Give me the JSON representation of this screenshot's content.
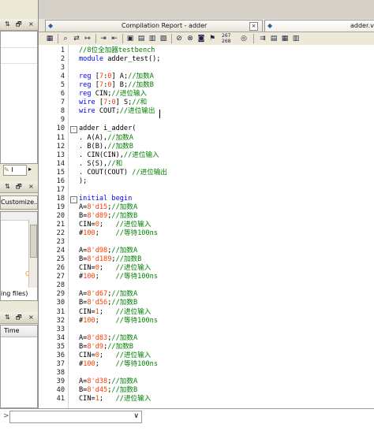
{
  "left_panel": {
    "panel1_buttons": [
      "⇅",
      "🗗",
      "×"
    ],
    "tab_label": "I",
    "panel2_buttons": [
      "⇅",
      "🗗",
      "×"
    ],
    "customize_label": "Customize...",
    "orange_char": "C",
    "files_text": "ing files)",
    "panel3_buttons": [
      "⇅",
      "🗗",
      "×"
    ],
    "time_header": "Time"
  },
  "tabs": {
    "tab1": "Compilation Report - adder",
    "tab2": "adder.v"
  },
  "toolbar": {
    "counter_top": "267",
    "counter_bottom": "268"
  },
  "editor": {
    "lines": [
      {
        "n": "1",
        "t": [
          [
            "c",
            "//8位全加器testbench"
          ]
        ]
      },
      {
        "n": "2",
        "t": [
          [
            "k",
            "module "
          ],
          [
            "p",
            "adder_test();"
          ]
        ]
      },
      {
        "n": "3",
        "t": []
      },
      {
        "n": "4",
        "t": [
          [
            "k",
            "reg "
          ],
          [
            "p",
            "["
          ],
          [
            "n",
            "7"
          ],
          [
            "p",
            ":"
          ],
          [
            "n",
            "0"
          ],
          [
            "p",
            "] A;"
          ],
          [
            "c",
            "//加数A"
          ]
        ]
      },
      {
        "n": "5",
        "t": [
          [
            "k",
            "reg "
          ],
          [
            "p",
            "["
          ],
          [
            "n",
            "7"
          ],
          [
            "p",
            ":"
          ],
          [
            "n",
            "0"
          ],
          [
            "p",
            "] B;"
          ],
          [
            "c",
            "//加数B"
          ]
        ]
      },
      {
        "n": "6",
        "t": [
          [
            "k",
            "reg "
          ],
          [
            "p",
            "CIN;"
          ],
          [
            "c",
            "//进位输入"
          ]
        ]
      },
      {
        "n": "7",
        "t": [
          [
            "k",
            "wire "
          ],
          [
            "p",
            "["
          ],
          [
            "n",
            "7"
          ],
          [
            "p",
            ":"
          ],
          [
            "n",
            "0"
          ],
          [
            "p",
            "] S;"
          ],
          [
            "c",
            "//和"
          ]
        ]
      },
      {
        "n": "8",
        "t": [
          [
            "k",
            "wire "
          ],
          [
            "p",
            "COUT;"
          ],
          [
            "c",
            "//进位输出"
          ]
        ]
      },
      {
        "n": "9",
        "t": []
      },
      {
        "n": "10",
        "fold": "-",
        "t": [
          [
            "p",
            "adder i_adder("
          ]
        ]
      },
      {
        "n": "11",
        "t": [
          [
            "p",
            ". A(A),"
          ],
          [
            "c",
            "//加数A"
          ]
        ]
      },
      {
        "n": "12",
        "t": [
          [
            "p",
            ". B(B),"
          ],
          [
            "c",
            "//加数B"
          ]
        ]
      },
      {
        "n": "13",
        "t": [
          [
            "p",
            ". CIN(CIN),"
          ],
          [
            "c",
            "//进位输入"
          ]
        ]
      },
      {
        "n": "14",
        "t": [
          [
            "p",
            ". S(S),"
          ],
          [
            "c",
            "//和"
          ]
        ]
      },
      {
        "n": "15",
        "t": [
          [
            "p",
            ". COUT(COUT) "
          ],
          [
            "c",
            "//进位输出"
          ]
        ]
      },
      {
        "n": "16",
        "t": [
          [
            "p",
            ");"
          ]
        ]
      },
      {
        "n": "17",
        "t": []
      },
      {
        "n": "18",
        "fold": "-",
        "t": [
          [
            "k",
            "initial begin"
          ]
        ]
      },
      {
        "n": "19",
        "t": [
          [
            "p",
            "A="
          ],
          [
            "n",
            "8'd15"
          ],
          [
            "p",
            ";"
          ],
          [
            "c",
            "//加数A"
          ]
        ]
      },
      {
        "n": "20",
        "t": [
          [
            "p",
            "B="
          ],
          [
            "n",
            "8'd89"
          ],
          [
            "p",
            ";"
          ],
          [
            "c",
            "//加数B"
          ]
        ]
      },
      {
        "n": "21",
        "t": [
          [
            "p",
            "CIN="
          ],
          [
            "n",
            "0"
          ],
          [
            "p",
            ";   "
          ],
          [
            "c",
            "//进位输入"
          ]
        ]
      },
      {
        "n": "22",
        "t": [
          [
            "p",
            "#"
          ],
          [
            "n",
            "100"
          ],
          [
            "p",
            ";    "
          ],
          [
            "c",
            "//等待100ns"
          ]
        ]
      },
      {
        "n": "23",
        "t": []
      },
      {
        "n": "24",
        "t": [
          [
            "p",
            "A="
          ],
          [
            "n",
            "8'd98"
          ],
          [
            "p",
            ";"
          ],
          [
            "c",
            "//加数A"
          ]
        ]
      },
      {
        "n": "25",
        "t": [
          [
            "p",
            "B="
          ],
          [
            "n",
            "8'd189"
          ],
          [
            "p",
            ";"
          ],
          [
            "c",
            "//加数B"
          ]
        ]
      },
      {
        "n": "26",
        "t": [
          [
            "p",
            "CIN="
          ],
          [
            "n",
            "0"
          ],
          [
            "p",
            ";   "
          ],
          [
            "c",
            "//进位输入"
          ]
        ]
      },
      {
        "n": "27",
        "t": [
          [
            "p",
            "#"
          ],
          [
            "n",
            "100"
          ],
          [
            "p",
            ";    "
          ],
          [
            "c",
            "//等待100ns"
          ]
        ]
      },
      {
        "n": "28",
        "t": []
      },
      {
        "n": "29",
        "t": [
          [
            "p",
            "A="
          ],
          [
            "n",
            "8'd67"
          ],
          [
            "p",
            ";"
          ],
          [
            "c",
            "//加数A"
          ]
        ]
      },
      {
        "n": "30",
        "t": [
          [
            "p",
            "B="
          ],
          [
            "n",
            "8'd56"
          ],
          [
            "p",
            ";"
          ],
          [
            "c",
            "//加数B"
          ]
        ]
      },
      {
        "n": "31",
        "t": [
          [
            "p",
            "CIN="
          ],
          [
            "n",
            "1"
          ],
          [
            "p",
            ";   "
          ],
          [
            "c",
            "//进位输入"
          ]
        ]
      },
      {
        "n": "32",
        "t": [
          [
            "p",
            "#"
          ],
          [
            "n",
            "100"
          ],
          [
            "p",
            ";    "
          ],
          [
            "c",
            "//等待100ns"
          ]
        ]
      },
      {
        "n": "33",
        "t": []
      },
      {
        "n": "34",
        "t": [
          [
            "p",
            "A="
          ],
          [
            "n",
            "8'd83"
          ],
          [
            "p",
            ";"
          ],
          [
            "c",
            "//加数A"
          ]
        ]
      },
      {
        "n": "35",
        "t": [
          [
            "p",
            "B="
          ],
          [
            "n",
            "8'd9"
          ],
          [
            "p",
            ";"
          ],
          [
            "c",
            "//加数B"
          ]
        ]
      },
      {
        "n": "36",
        "t": [
          [
            "p",
            "CIN="
          ],
          [
            "n",
            "0"
          ],
          [
            "p",
            ";   "
          ],
          [
            "c",
            "//进位输入"
          ]
        ]
      },
      {
        "n": "37",
        "t": [
          [
            "p",
            "#"
          ],
          [
            "n",
            "100"
          ],
          [
            "p",
            ";    "
          ],
          [
            "c",
            "//等待100ns"
          ]
        ]
      },
      {
        "n": "38",
        "t": []
      },
      {
        "n": "39",
        "t": [
          [
            "p",
            "A="
          ],
          [
            "n",
            "8'd38"
          ],
          [
            "p",
            ";"
          ],
          [
            "c",
            "//加数A"
          ]
        ]
      },
      {
        "n": "40",
        "t": [
          [
            "p",
            "B="
          ],
          [
            "n",
            "8'd45"
          ],
          [
            "p",
            ";"
          ],
          [
            "c",
            "//加数B"
          ]
        ]
      },
      {
        "n": "41",
        "t": [
          [
            "p",
            "CIN="
          ],
          [
            "n",
            "1"
          ],
          [
            "p",
            ";   "
          ],
          [
            "c",
            "//进位输入"
          ]
        ]
      }
    ]
  },
  "bottom": {
    "prompt": ">"
  },
  "colors": {
    "keyword": "#0000ff",
    "comment": "#008000",
    "number": "#ff3b00"
  }
}
